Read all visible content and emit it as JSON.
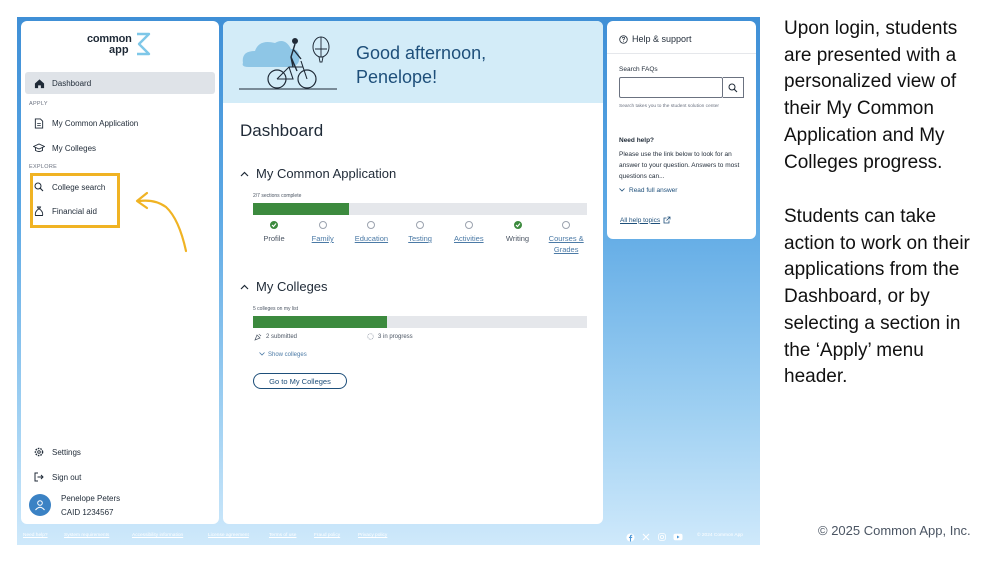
{
  "logo": {
    "line1": "common",
    "line2": "app"
  },
  "sidebar": {
    "dashboard": "Dashboard",
    "section_apply": "APPLY",
    "my_common_application": "My Common Application",
    "my_colleges": "My Colleges",
    "section_explore": "EXPLORE",
    "college_search": "College search",
    "financial_aid": "Financial aid",
    "settings": "Settings",
    "sign_out": "Sign out",
    "user_name": "Penelope Peters",
    "user_id": "CAID 1234567"
  },
  "hero": {
    "greeting": "Good afternoon, Penelope!"
  },
  "main": {
    "title": "Dashboard",
    "mca": {
      "title": "My Common Application",
      "progress_text": "2/7 sections complete",
      "progress": 0.286,
      "steps": [
        {
          "label": "Profile",
          "done": true
        },
        {
          "label": "Family",
          "done": false
        },
        {
          "label": "Education",
          "done": false
        },
        {
          "label": "Testing",
          "done": false
        },
        {
          "label": "Activities",
          "done": false
        },
        {
          "label": "Writing",
          "done": true
        },
        {
          "label": "Courses & Grades",
          "done": false
        }
      ]
    },
    "colleges": {
      "title": "My Colleges",
      "count_text": "5 colleges on my list",
      "progress": 0.4,
      "submitted": "2 submitted",
      "in_progress": "3 in progress",
      "show_colleges": "Show colleges",
      "go_button": "Go to My Colleges"
    }
  },
  "help": {
    "title": "Help & support",
    "search_label": "Search FAQs",
    "search_value": "",
    "search_note": "Search takes you to the student solution center",
    "need_help": "Need help?",
    "body": "Please use the link below to look for an answer to your question. Answers to most questions can...",
    "read_full": "Read full answer",
    "all_topics": "All help topics"
  },
  "footer": {
    "links": [
      "Need help?",
      "System requirements",
      "Accessibility information",
      "License agreement",
      "Terms of use",
      "Fraud policy",
      "Privacy policy"
    ],
    "social": [
      "facebook-icon",
      "x-icon",
      "instagram-icon",
      "youtube-icon"
    ],
    "copyright": "© 2024 Common App"
  },
  "caption": {
    "p1": "Upon login, students are presented with a personalized view of their My Common Application and My Colleges progress.",
    "p2": "Students can take action to work on their applications from the Dashboard, or by selecting a section in the ‘Apply’ menu header.",
    "copyright": "© 2025 Common App, Inc."
  },
  "colors": {
    "accent_green": "#3c8a3e",
    "brand_blue": "#1e4f7a",
    "highlight": "#f0b323"
  }
}
